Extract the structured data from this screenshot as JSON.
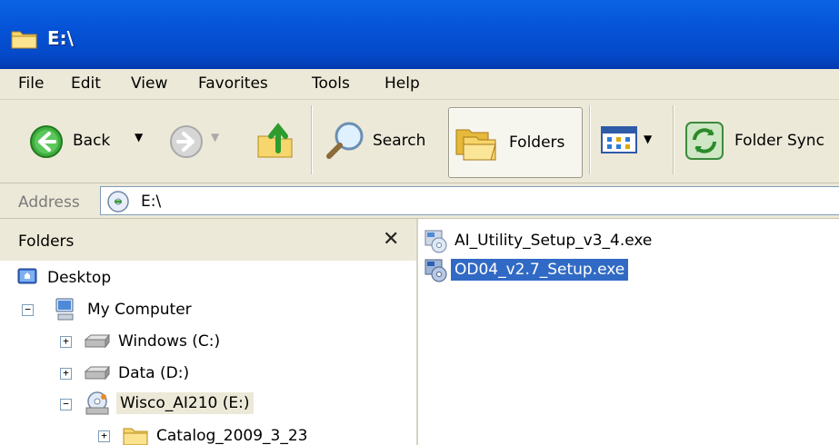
{
  "window": {
    "title": "E:\\"
  },
  "menu": {
    "items": [
      "File",
      "Edit",
      "View",
      "Favorites",
      "Tools",
      "Help"
    ]
  },
  "toolbar": {
    "back_label": "Back",
    "search_label": "Search",
    "folders_label": "Folders",
    "folder_sync_label": "Folder Sync"
  },
  "address": {
    "label": "Address",
    "value": "E:\\"
  },
  "folders_pane": {
    "title": "Folders",
    "close_glyph": "✕",
    "tree": {
      "desktop": "Desktop",
      "my_computer": "My Computer",
      "windows_drive": "Windows (C:)",
      "data_drive": "Data (D:)",
      "wisco_drive": "Wisco_AI210 (E:)",
      "catalog_folder": "Catalog_2009_3_23"
    },
    "expand_glyph": "+",
    "collapse_glyph": "−"
  },
  "files": [
    {
      "name": "AI_Utility_Setup_v3_4.exe",
      "selected": false
    },
    {
      "name": "OD04_v2.7_Setup.exe",
      "selected": true
    }
  ],
  "colors": {
    "titlebar": "#0653d8",
    "selection": "#316ac5",
    "chrome": "#ece9d8"
  }
}
